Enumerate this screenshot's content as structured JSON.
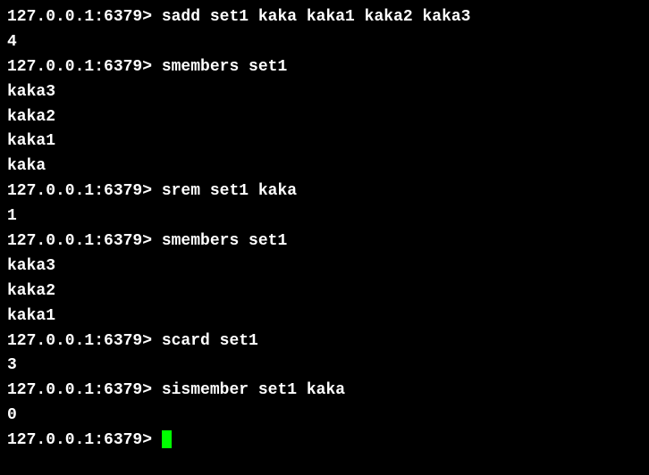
{
  "session": {
    "prompt": "127.0.0.1:6379> ",
    "lines": [
      {
        "type": "command",
        "text": "sadd set1 kaka kaka1 kaka2 kaka3"
      },
      {
        "type": "output",
        "text": "4"
      },
      {
        "type": "command",
        "text": "smembers set1"
      },
      {
        "type": "output",
        "text": "kaka3"
      },
      {
        "type": "output",
        "text": "kaka2"
      },
      {
        "type": "output",
        "text": "kaka1"
      },
      {
        "type": "output",
        "text": "kaka"
      },
      {
        "type": "command",
        "text": "srem set1 kaka"
      },
      {
        "type": "output",
        "text": "1"
      },
      {
        "type": "command",
        "text": "smembers set1"
      },
      {
        "type": "output",
        "text": "kaka3"
      },
      {
        "type": "output",
        "text": "kaka2"
      },
      {
        "type": "output",
        "text": "kaka1"
      },
      {
        "type": "command",
        "text": "scard set1"
      },
      {
        "type": "output",
        "text": "3"
      },
      {
        "type": "command",
        "text": "sismember set1 kaka"
      },
      {
        "type": "output",
        "text": "0"
      },
      {
        "type": "prompt-cursor",
        "text": ""
      }
    ]
  }
}
